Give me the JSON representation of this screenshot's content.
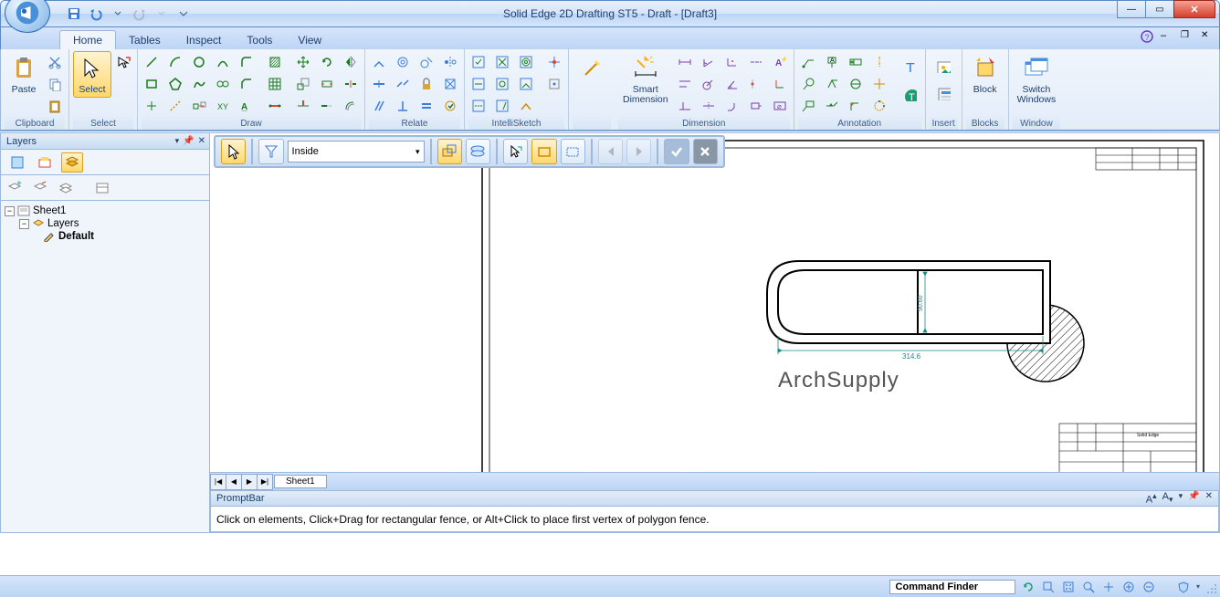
{
  "title": "Solid Edge 2D Drafting ST5 - Draft - [Draft3]",
  "tabs": {
    "home": "Home",
    "tables": "Tables",
    "inspect": "Inspect",
    "tools": "Tools",
    "view": "View"
  },
  "panels": {
    "clipboard": "Clipboard",
    "select": "Select",
    "draw": "Draw",
    "relate": "Relate",
    "intellisketch": "IntelliSketch",
    "dimension": "Dimension",
    "annotation": "Annotation",
    "insert": "Insert",
    "blocks": "Blocks",
    "window": "Window"
  },
  "buttons": {
    "paste": "Paste",
    "select": "Select",
    "smartdim": "Smart\nDimension",
    "block": "Block",
    "switchwin": "Switch\nWindows"
  },
  "leftpane": {
    "title": "Layers",
    "sheet": "Sheet1",
    "layers": "Layers",
    "default": "Default"
  },
  "toolbar": {
    "combo": "Inside"
  },
  "sheet_tab": "Sheet1",
  "promptbar": {
    "title": "PromptBar",
    "msg": "Click on elements, Click+Drag for rectangular fence, or Alt+Click to place first vertex of polygon fence."
  },
  "status": {
    "cmdfinder": "Command Finder"
  },
  "drawing": {
    "watermark": "ArchSupply",
    "dim_h": "314.6",
    "dim_v": "90.60",
    "titleblock": "Solid Edge"
  }
}
